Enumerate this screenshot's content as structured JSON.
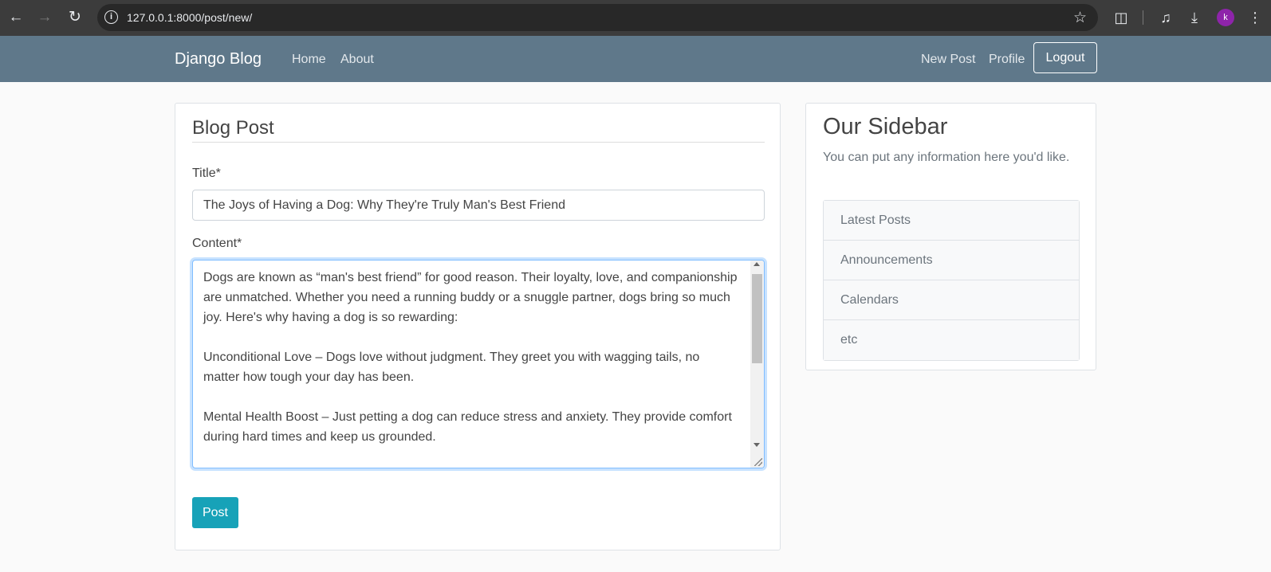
{
  "browser": {
    "url": "127.0.0.1:8000/post/new/",
    "avatar_letter": "k"
  },
  "navbar": {
    "brand": "Django Blog",
    "links": [
      "Home",
      "About",
      "New Post",
      "Profile"
    ],
    "logout": "Logout",
    "color": "#5f788a"
  },
  "form": {
    "legend": "Blog Post",
    "title_label": "Title*",
    "title_value": "The Joys of Having a Dog: Why They're Truly Man's Best Friend",
    "content_label": "Content*",
    "content_value": "Dogs are known as “man's best friend” for good reason. Their loyalty, love, and companionship are unmatched. Whether you need a running buddy or a snuggle partner, dogs bring so much joy. Here's why having a dog is so rewarding:\n\nUnconditional Love – Dogs love without judgment. They greet you with wagging tails, no matter how tough your day has been.\n\nMental Health Boost – Just petting a dog can reduce stress and anxiety. They provide comfort during hard times and keep us grounded.",
    "submit": "Post",
    "submit_color": "#17a2b8"
  },
  "sidebar": {
    "title": "Our Sidebar",
    "text": "You can put any information here you'd like.",
    "items": [
      "Latest Posts",
      "Announcements",
      "Calendars",
      "etc"
    ]
  }
}
